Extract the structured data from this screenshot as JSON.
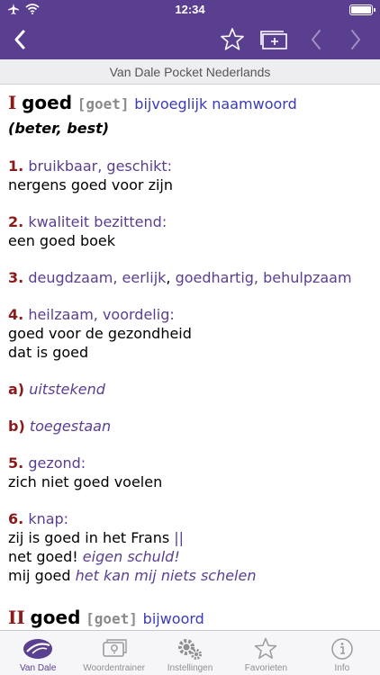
{
  "status": {
    "time": "12:34"
  },
  "subtitle": "Van Dale Pocket Nederlands",
  "entry1": {
    "roman": "I",
    "lemma": "goed",
    "pron": "[goet]",
    "pos": "bijvoeglijk naamwoord",
    "forms": "(beter, best)",
    "senses": [
      {
        "num": "1.",
        "meaning": "bruikbaar, geschikt:",
        "ex": "nergens goed voor zijn"
      },
      {
        "num": "2.",
        "meaning": "kwaliteit bezittend:",
        "ex": "een goed boek"
      },
      {
        "num": "3.",
        "m1": "deugdzaam, eerlijk",
        "sep": ", ",
        "m2": "goedhartig, behulpzaam"
      },
      {
        "num": "4.",
        "meaning": "heilzaam, voordelig:",
        "ex1": "goed voor de gezondheid",
        "ex2": "dat is goed"
      },
      {
        "num": "a)",
        "meaning": "uitstekend"
      },
      {
        "num": "b)",
        "meaning": "toegestaan"
      },
      {
        "num": "5.",
        "meaning": "gezond:",
        "ex": "zich niet goed voelen"
      },
      {
        "num": "6.",
        "meaning": "knap:",
        "ex1": "zij is goed in het Frans",
        "bar": "||",
        "ex2a": "net goed!",
        "ex2b": "eigen schuld!",
        "ex3a": "mij goed",
        "ex3b": "het kan mij niets schelen"
      }
    ]
  },
  "entry2": {
    "roman": "II",
    "lemma": "goed",
    "pron": "[goet]",
    "pos": "bijwoord"
  },
  "tabs": [
    {
      "label": "Van Dale",
      "icon": "van-dale-logo-icon"
    },
    {
      "label": "Woordentrainer",
      "icon": "flashcard-icon"
    },
    {
      "label": "Instellingen",
      "icon": "gear-icon"
    },
    {
      "label": "Favorieten",
      "icon": "star-icon"
    },
    {
      "label": "Info",
      "icon": "info-icon"
    }
  ],
  "colors": {
    "accent": "#5a3e8f",
    "sense_number": "#8b1a1a",
    "pos": "#3a3ab8"
  }
}
